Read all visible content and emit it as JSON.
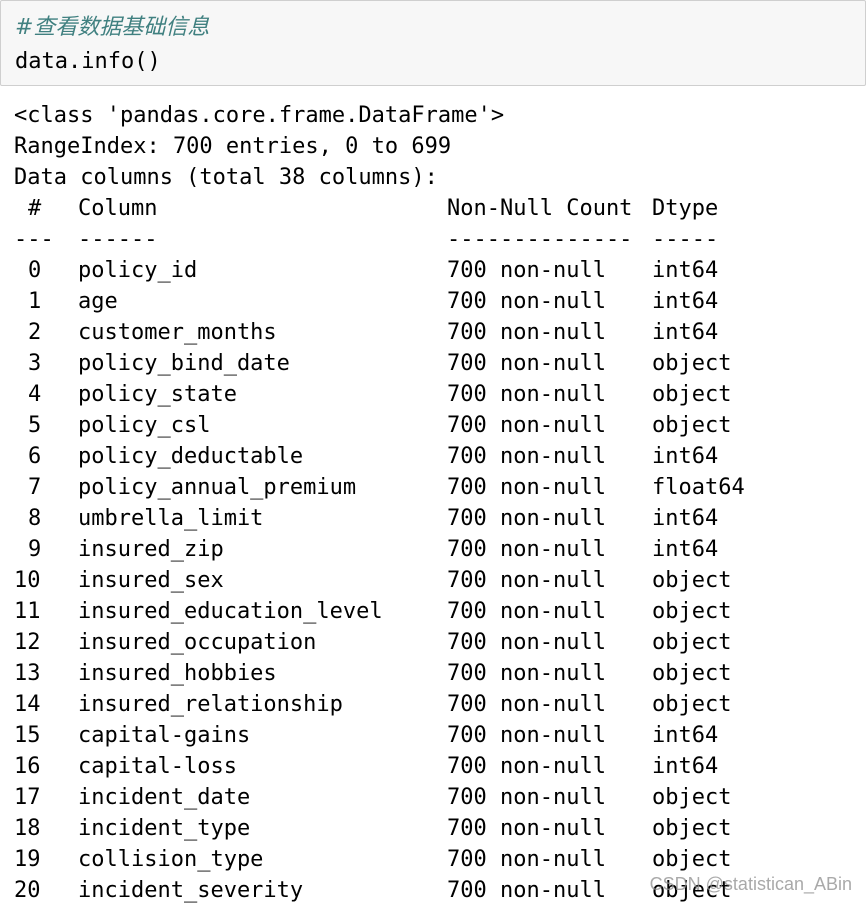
{
  "input": {
    "comment": "#查看数据基础信息",
    "code": "data.info()"
  },
  "output": {
    "class_line": "<class 'pandas.core.frame.DataFrame'>",
    "range_index": "RangeIndex: 700 entries, 0 to 699",
    "columns_summary": "Data columns (total 38 columns):",
    "headers": {
      "num": "#",
      "column": "Column",
      "count": "Non-Null Count",
      "dtype": "Dtype"
    },
    "separators": {
      "num": "---",
      "column": "------",
      "count": "--------------",
      "dtype": "-----"
    },
    "rows": [
      {
        "num": "0",
        "column": "policy_id",
        "count": "700 non-null",
        "dtype": "int64"
      },
      {
        "num": "1",
        "column": "age",
        "count": "700 non-null",
        "dtype": "int64"
      },
      {
        "num": "2",
        "column": "customer_months",
        "count": "700 non-null",
        "dtype": "int64"
      },
      {
        "num": "3",
        "column": "policy_bind_date",
        "count": "700 non-null",
        "dtype": "object"
      },
      {
        "num": "4",
        "column": "policy_state",
        "count": "700 non-null",
        "dtype": "object"
      },
      {
        "num": "5",
        "column": "policy_csl",
        "count": "700 non-null",
        "dtype": "object"
      },
      {
        "num": "6",
        "column": "policy_deductable",
        "count": "700 non-null",
        "dtype": "int64"
      },
      {
        "num": "7",
        "column": "policy_annual_premium",
        "count": "700 non-null",
        "dtype": "float64"
      },
      {
        "num": "8",
        "column": "umbrella_limit",
        "count": "700 non-null",
        "dtype": "int64"
      },
      {
        "num": "9",
        "column": "insured_zip",
        "count": "700 non-null",
        "dtype": "int64"
      },
      {
        "num": "10",
        "column": "insured_sex",
        "count": "700 non-null",
        "dtype": "object"
      },
      {
        "num": "11",
        "column": "insured_education_level",
        "count": "700 non-null",
        "dtype": "object"
      },
      {
        "num": "12",
        "column": "insured_occupation",
        "count": "700 non-null",
        "dtype": "object"
      },
      {
        "num": "13",
        "column": "insured_hobbies",
        "count": "700 non-null",
        "dtype": "object"
      },
      {
        "num": "14",
        "column": "insured_relationship",
        "count": "700 non-null",
        "dtype": "object"
      },
      {
        "num": "15",
        "column": "capital-gains",
        "count": "700 non-null",
        "dtype": "int64"
      },
      {
        "num": "16",
        "column": "capital-loss",
        "count": "700 non-null",
        "dtype": "int64"
      },
      {
        "num": "17",
        "column": "incident_date",
        "count": "700 non-null",
        "dtype": "object"
      },
      {
        "num": "18",
        "column": "incident_type",
        "count": "700 non-null",
        "dtype": "object"
      },
      {
        "num": "19",
        "column": "collision_type",
        "count": "700 non-null",
        "dtype": "object"
      },
      {
        "num": "20",
        "column": "incident_severity",
        "count": "700 non-null",
        "dtype": "object"
      }
    ]
  },
  "watermark": "CSDN @statistican_ABin"
}
